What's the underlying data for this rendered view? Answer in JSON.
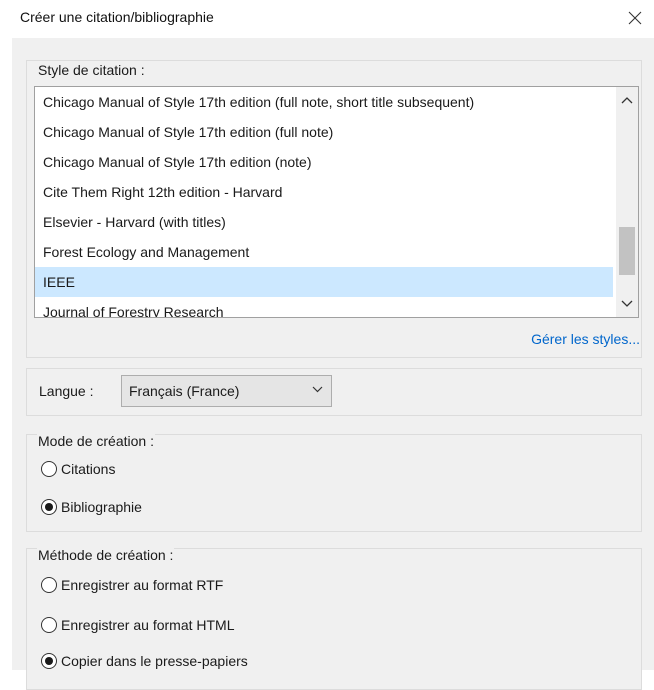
{
  "dialog": {
    "title": "Créer une citation/bibliographie"
  },
  "citation_style": {
    "label": "Style de citation :",
    "items": [
      "Chicago Manual of Style 17th edition (full note, short title subsequent)",
      "Chicago Manual of Style 17th edition (full note)",
      "Chicago Manual of Style 17th edition (note)",
      "Cite Them Right 12th edition - Harvard",
      "Elsevier - Harvard (with titles)",
      "Forest Ecology and Management",
      "IEEE",
      "Journal of Forestry Research"
    ],
    "selected_index": 6,
    "manage_link": "Gérer les styles..."
  },
  "language": {
    "label": "Langue :",
    "value": "Français (France)"
  },
  "creation_mode": {
    "label": "Mode de création :",
    "options": [
      "Citations",
      "Bibliographie"
    ],
    "selected": "Bibliographie"
  },
  "creation_method": {
    "label": "Méthode de création :",
    "options": [
      "Enregistrer au format RTF",
      "Enregistrer au format HTML",
      "Copier dans le presse-papiers"
    ],
    "selected": "Copier dans le presse-papiers"
  },
  "colors": {
    "selection": "#cce8ff",
    "link": "#0066cc",
    "panel": "#f0f0f0"
  }
}
